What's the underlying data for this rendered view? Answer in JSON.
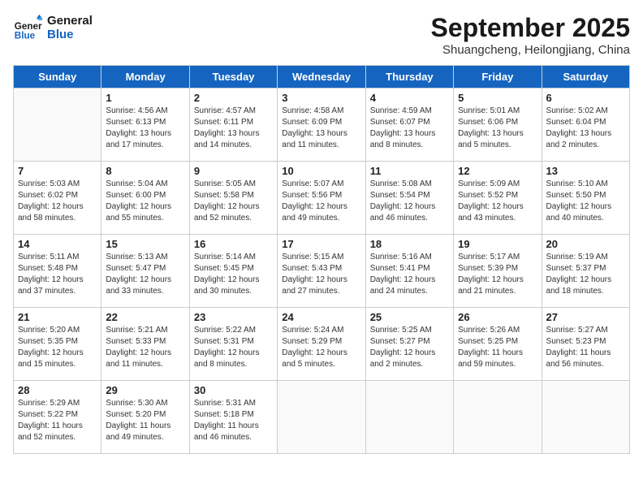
{
  "header": {
    "logo_line1": "General",
    "logo_line2": "Blue",
    "month": "September 2025",
    "location": "Shuangcheng, Heilongjiang, China"
  },
  "weekdays": [
    "Sunday",
    "Monday",
    "Tuesday",
    "Wednesday",
    "Thursday",
    "Friday",
    "Saturday"
  ],
  "weeks": [
    [
      {
        "day": "",
        "info": ""
      },
      {
        "day": "1",
        "info": "Sunrise: 4:56 AM\nSunset: 6:13 PM\nDaylight: 13 hours\nand 17 minutes."
      },
      {
        "day": "2",
        "info": "Sunrise: 4:57 AM\nSunset: 6:11 PM\nDaylight: 13 hours\nand 14 minutes."
      },
      {
        "day": "3",
        "info": "Sunrise: 4:58 AM\nSunset: 6:09 PM\nDaylight: 13 hours\nand 11 minutes."
      },
      {
        "day": "4",
        "info": "Sunrise: 4:59 AM\nSunset: 6:07 PM\nDaylight: 13 hours\nand 8 minutes."
      },
      {
        "day": "5",
        "info": "Sunrise: 5:01 AM\nSunset: 6:06 PM\nDaylight: 13 hours\nand 5 minutes."
      },
      {
        "day": "6",
        "info": "Sunrise: 5:02 AM\nSunset: 6:04 PM\nDaylight: 13 hours\nand 2 minutes."
      }
    ],
    [
      {
        "day": "7",
        "info": "Sunrise: 5:03 AM\nSunset: 6:02 PM\nDaylight: 12 hours\nand 58 minutes."
      },
      {
        "day": "8",
        "info": "Sunrise: 5:04 AM\nSunset: 6:00 PM\nDaylight: 12 hours\nand 55 minutes."
      },
      {
        "day": "9",
        "info": "Sunrise: 5:05 AM\nSunset: 5:58 PM\nDaylight: 12 hours\nand 52 minutes."
      },
      {
        "day": "10",
        "info": "Sunrise: 5:07 AM\nSunset: 5:56 PM\nDaylight: 12 hours\nand 49 minutes."
      },
      {
        "day": "11",
        "info": "Sunrise: 5:08 AM\nSunset: 5:54 PM\nDaylight: 12 hours\nand 46 minutes."
      },
      {
        "day": "12",
        "info": "Sunrise: 5:09 AM\nSunset: 5:52 PM\nDaylight: 12 hours\nand 43 minutes."
      },
      {
        "day": "13",
        "info": "Sunrise: 5:10 AM\nSunset: 5:50 PM\nDaylight: 12 hours\nand 40 minutes."
      }
    ],
    [
      {
        "day": "14",
        "info": "Sunrise: 5:11 AM\nSunset: 5:48 PM\nDaylight: 12 hours\nand 37 minutes."
      },
      {
        "day": "15",
        "info": "Sunrise: 5:13 AM\nSunset: 5:47 PM\nDaylight: 12 hours\nand 33 minutes."
      },
      {
        "day": "16",
        "info": "Sunrise: 5:14 AM\nSunset: 5:45 PM\nDaylight: 12 hours\nand 30 minutes."
      },
      {
        "day": "17",
        "info": "Sunrise: 5:15 AM\nSunset: 5:43 PM\nDaylight: 12 hours\nand 27 minutes."
      },
      {
        "day": "18",
        "info": "Sunrise: 5:16 AM\nSunset: 5:41 PM\nDaylight: 12 hours\nand 24 minutes."
      },
      {
        "day": "19",
        "info": "Sunrise: 5:17 AM\nSunset: 5:39 PM\nDaylight: 12 hours\nand 21 minutes."
      },
      {
        "day": "20",
        "info": "Sunrise: 5:19 AM\nSunset: 5:37 PM\nDaylight: 12 hours\nand 18 minutes."
      }
    ],
    [
      {
        "day": "21",
        "info": "Sunrise: 5:20 AM\nSunset: 5:35 PM\nDaylight: 12 hours\nand 15 minutes."
      },
      {
        "day": "22",
        "info": "Sunrise: 5:21 AM\nSunset: 5:33 PM\nDaylight: 12 hours\nand 11 minutes."
      },
      {
        "day": "23",
        "info": "Sunrise: 5:22 AM\nSunset: 5:31 PM\nDaylight: 12 hours\nand 8 minutes."
      },
      {
        "day": "24",
        "info": "Sunrise: 5:24 AM\nSunset: 5:29 PM\nDaylight: 12 hours\nand 5 minutes."
      },
      {
        "day": "25",
        "info": "Sunrise: 5:25 AM\nSunset: 5:27 PM\nDaylight: 12 hours\nand 2 minutes."
      },
      {
        "day": "26",
        "info": "Sunrise: 5:26 AM\nSunset: 5:25 PM\nDaylight: 11 hours\nand 59 minutes."
      },
      {
        "day": "27",
        "info": "Sunrise: 5:27 AM\nSunset: 5:23 PM\nDaylight: 11 hours\nand 56 minutes."
      }
    ],
    [
      {
        "day": "28",
        "info": "Sunrise: 5:29 AM\nSunset: 5:22 PM\nDaylight: 11 hours\nand 52 minutes."
      },
      {
        "day": "29",
        "info": "Sunrise: 5:30 AM\nSunset: 5:20 PM\nDaylight: 11 hours\nand 49 minutes."
      },
      {
        "day": "30",
        "info": "Sunrise: 5:31 AM\nSunset: 5:18 PM\nDaylight: 11 hours\nand 46 minutes."
      },
      {
        "day": "",
        "info": ""
      },
      {
        "day": "",
        "info": ""
      },
      {
        "day": "",
        "info": ""
      },
      {
        "day": "",
        "info": ""
      }
    ]
  ]
}
